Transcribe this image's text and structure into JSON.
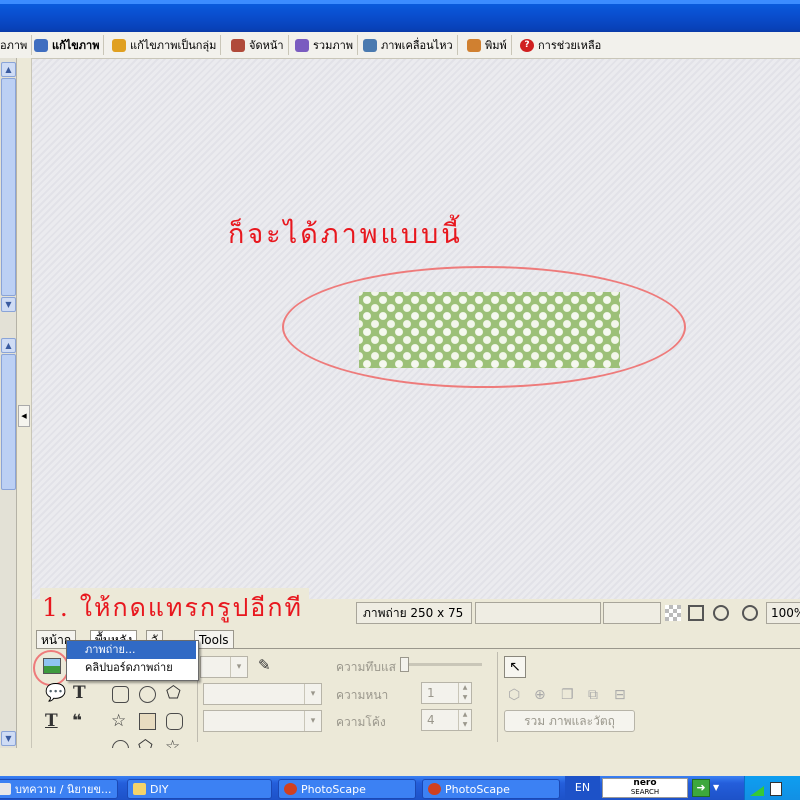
{
  "tabs": [
    {
      "label": "อภาพ",
      "active": false,
      "icon": "photo-viewer-icon",
      "color": "#6a8acb"
    },
    {
      "label": "แก้ไขภาพ",
      "active": true,
      "icon": "editor-icon",
      "color": "#3f6ec0"
    },
    {
      "label": "แก้ไขภาพเป็นกลุ่ม",
      "active": false,
      "icon": "batch-editor-icon",
      "color": "#e0a020"
    },
    {
      "label": "จัดหน้า",
      "active": false,
      "icon": "page-icon",
      "color": "#b04a3a"
    },
    {
      "label": "รวมภาพ",
      "active": false,
      "icon": "combine-icon",
      "color": "#7a5cc0"
    },
    {
      "label": "ภาพเคลื่อนไหว",
      "active": false,
      "icon": "animated-gif-icon",
      "color": "#4a7ab0"
    },
    {
      "label": "พิมพ์",
      "active": false,
      "icon": "print-icon",
      "color": "#d08030"
    },
    {
      "label": "การช่วยเหลือ",
      "active": false,
      "icon": "help-icon",
      "color": "#d02020"
    }
  ],
  "annotations": {
    "top_caption": "ก็จะได้ภาพแบบนี้",
    "bottom_caption": "1. ให้กดแทรกรูปอีกที"
  },
  "status": {
    "image_size": "ภาพถ่าย 250 x 75",
    "zoom": "100%"
  },
  "tool_tabs": [
    "หน้าก",
    "พื้นหลัง",
    "วั",
    "Tools"
  ],
  "context_menu": {
    "items": [
      {
        "label": "ภาพถ่าย...",
        "highlighted": true
      },
      {
        "label": "คลิปบอร์ดภาพถ่าย",
        "highlighted": false
      }
    ]
  },
  "properties": {
    "opacity_label": "ความทึบแส",
    "thickness_label": "ความหนา",
    "thickness_value": "1",
    "roundness_label": "ความโค้ง",
    "roundness_value": "4",
    "merge_button": "รวม ภาพและวัตถุ"
  },
  "taskbar": {
    "items": [
      {
        "label": "บทความ / นิยายข...",
        "icon": "browser-icon"
      },
      {
        "label": "DIY",
        "icon": "folder-icon"
      },
      {
        "label": "PhotoScape",
        "icon": "photoscape-icon"
      },
      {
        "label": "PhotoScape",
        "icon": "photoscape-icon"
      }
    ],
    "language": "EN",
    "nero_label": "nero",
    "nero_sub": "SEARCH"
  },
  "colors": {
    "annotation_red": "#e8171e",
    "ellipse_pink": "#ee7b7b",
    "photo_green": "#9cc078",
    "menu_highlight": "#316ac5",
    "title_blue": "#0a4fd0"
  }
}
